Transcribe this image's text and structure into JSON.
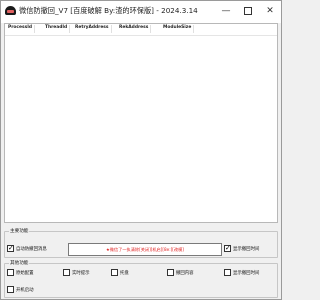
{
  "window": {
    "title": "微信防撤回_V7 [百度破解 By:渣的环保版] - 2024.3.14",
    "minimize": "—",
    "maximize": "",
    "close": "✕"
  },
  "table": {
    "columns": [
      "ProcessId",
      "ThreadId",
      "RetryAddress",
      "RekAddress",
      "ModuleSize"
    ],
    "rows": []
  },
  "section_main": {
    "title": "主要功能",
    "auto_anti_revoke": {
      "label": "自动防撤回消息",
      "checked": true
    },
    "status_text": "★微信了一执清除[关闭][机启][8e:][改模]",
    "show_time": {
      "label": "显示撤回时间",
      "checked": true
    }
  },
  "section_extra": {
    "title": "其他功能",
    "items": [
      {
        "label": "原始配置",
        "checked": false
      },
      {
        "label": "实时提示",
        "checked": false
      },
      {
        "label": "托盘",
        "checked": false
      },
      {
        "label": "撤回内容",
        "checked": false
      },
      {
        "label": "显示撤回时间",
        "checked": false
      }
    ],
    "autostart": {
      "label": "开机启动",
      "checked": false
    }
  },
  "colors": {
    "status_red": "#e02020",
    "window_bg": "#f0f0f0"
  }
}
